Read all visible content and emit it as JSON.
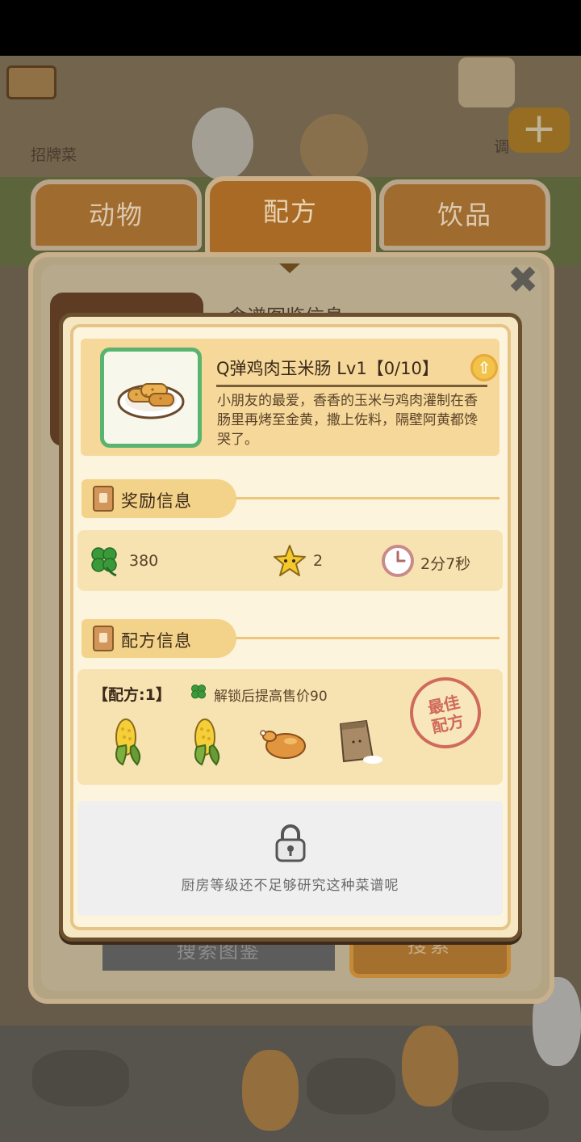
{
  "scene": {
    "signature_dish_label": "招牌菜",
    "right_edge_label": "调"
  },
  "tabs": [
    {
      "label": "动物",
      "active": false
    },
    {
      "label": "配方",
      "active": true
    },
    {
      "label": "饮品",
      "active": false
    }
  ],
  "back_panel": {
    "title": "食谱图鉴信息",
    "search_placeholder": "搜索图鉴",
    "search_button": "搜索"
  },
  "recipe": {
    "title": "Q弹鸡肉玉米肠 Lv1【0/10】",
    "description": "小朋友的最爱，香香的玉米与鸡肉灌制在香肠里再烤至金黄，撒上佐料，隔壁阿黄都馋哭了。",
    "food_icon": "corn-sausage-plate-icon"
  },
  "reward_section": {
    "title": "奖励信息",
    "items": [
      {
        "icon": "clover-icon",
        "value": "380"
      },
      {
        "icon": "star-icon",
        "value": "2"
      },
      {
        "icon": "clock-icon",
        "value": "2分7秒"
      }
    ]
  },
  "formula_section": {
    "title": "配方信息",
    "formula_label": "【配方:1】",
    "bonus_text": "解锁后提高售价90",
    "ingredients": [
      "corn-icon",
      "corn-icon",
      "roast-chicken-icon",
      "flour-bag-icon"
    ],
    "stamp_text": [
      "最佳",
      "配方"
    ]
  },
  "locked": {
    "message": "厨房等级还不足够研究这种菜谱呢"
  },
  "colors": {
    "accent_orange": "#a86a24",
    "dialog_bg": "#fdf4dd",
    "clover_green": "#3a9a3a",
    "star_yellow": "#f5c92c"
  }
}
